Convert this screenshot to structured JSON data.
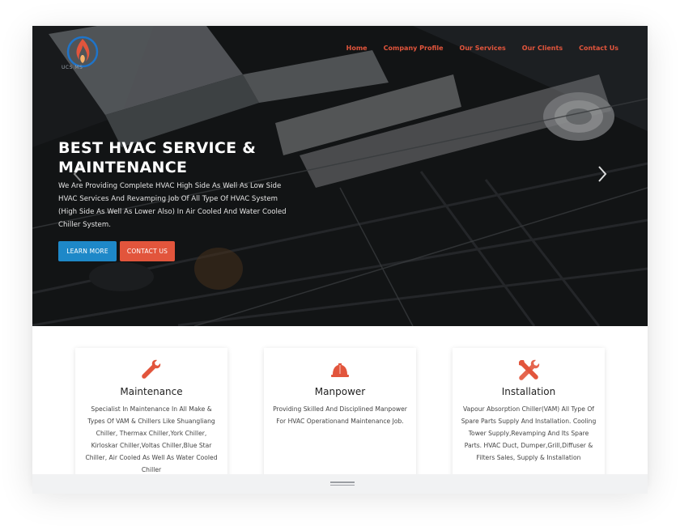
{
  "header": {
    "logo_text": "UCS MS",
    "nav": [
      {
        "label": "Home"
      },
      {
        "label": "Company Profile"
      },
      {
        "label": "Our Services"
      },
      {
        "label": "Our Clients"
      },
      {
        "label": "Contact Us"
      }
    ]
  },
  "hero": {
    "title": "BEST HVAC SERVICE & MAINTENANCE",
    "text": "We Are Providing Complete HVAC High Side As Well As Low Side HVAC Services And Revamping Job Of All Type Of HVAC System (High Side As Well As Lower Also) In Air Cooled And Water Cooled Chiller System.",
    "learn_more": "LEARN MORE",
    "contact_us": "CONTACT US"
  },
  "services": [
    {
      "icon": "wrench-icon",
      "title": "Maintenance",
      "text": "Specialist In Maintenance In All Make & Types Of VAM & Chillers Like Shuangliang Chiller, Thermax Chiller,York Chiller, Kirloskar Chiller,Voltas Chiller,Blue Star Chiller, Air Cooled As Well As Water Cooled Chiller"
    },
    {
      "icon": "hard-hat-icon",
      "title": "Manpower",
      "text": "Providing Skilled And Disciplined Manpower For HVAC Operationand Maintenance Job."
    },
    {
      "icon": "tools-icon",
      "title": "Installation",
      "text": "Vapour Absorption Chiller(VAM) All Type Of Spare Parts Supply And Installation. Cooling Tower Supply,Revamping And Its Spare Parts. HVAC Duct, Dumper,Grill,Diffuser & Filters Sales, Supply & Installation"
    }
  ],
  "colors": {
    "accent_red": "#e2553c",
    "accent_blue": "#1e88c8"
  }
}
